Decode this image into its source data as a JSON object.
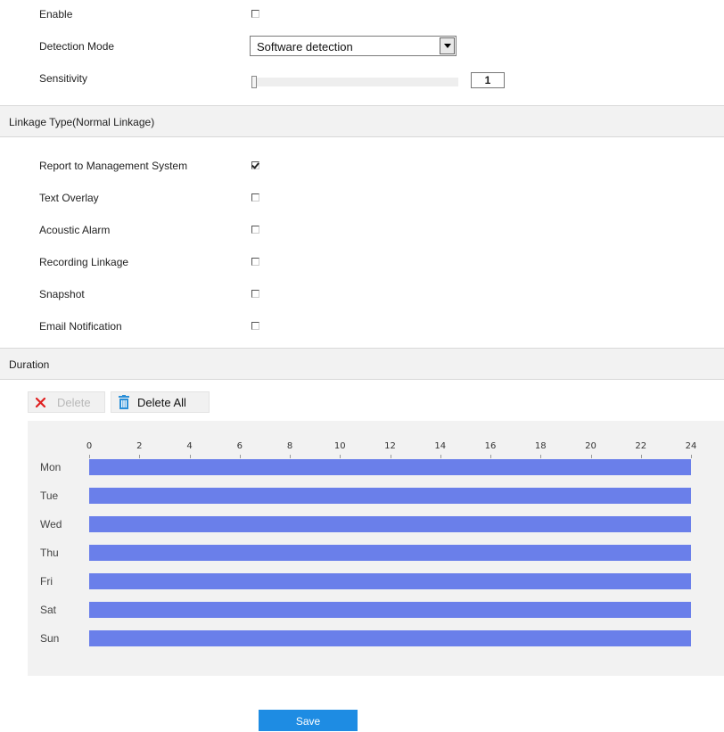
{
  "form": {
    "enable_label": "Enable",
    "enable_checked": false,
    "detection_mode_label": "Detection Mode",
    "detection_mode_value": "Software detection",
    "sensitivity_label": "Sensitivity",
    "sensitivity_value": "1"
  },
  "linkage": {
    "title": "Linkage Type(Normal Linkage)",
    "items": [
      {
        "label": "Report to Management System",
        "checked": true
      },
      {
        "label": "Text Overlay",
        "checked": false
      },
      {
        "label": "Acoustic Alarm",
        "checked": false
      },
      {
        "label": "Recording Linkage",
        "checked": false
      },
      {
        "label": "Snapshot",
        "checked": false
      },
      {
        "label": "Email Notification",
        "checked": false
      }
    ]
  },
  "duration": {
    "title": "Duration",
    "delete_label": "Delete",
    "delete_all_label": "Delete All",
    "hours": [
      "0",
      "2",
      "4",
      "6",
      "8",
      "10",
      "12",
      "14",
      "16",
      "18",
      "20",
      "22",
      "24"
    ],
    "days": [
      "Mon",
      "Tue",
      "Wed",
      "Thu",
      "Fri",
      "Sat",
      "Sun"
    ],
    "schedule_start_hour": 0,
    "schedule_end_hour": 24
  },
  "save_label": "Save",
  "colors": {
    "schedule_bar": "#6a7fea",
    "save_button": "#1e8ce3",
    "delete_icon": "#e02020",
    "trash_icon": "#2a8fd8"
  }
}
